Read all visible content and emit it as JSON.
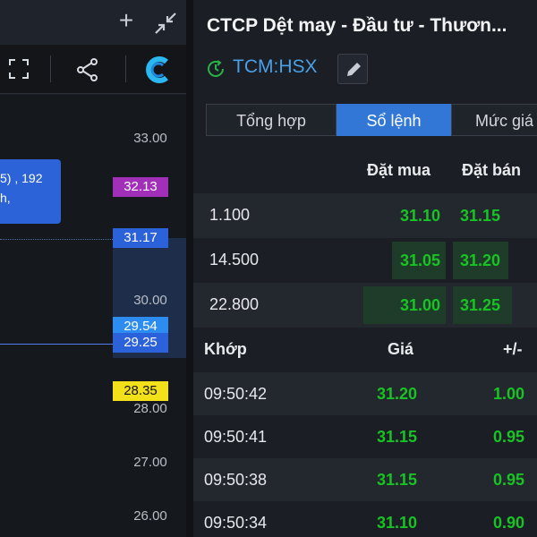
{
  "chart": {
    "price_ticks": [
      "33.00",
      "30.00",
      "28.00",
      "27.00",
      "26.00"
    ],
    "tooltip_line1": "5) , 192",
    "tooltip_line2": "h,",
    "labels": [
      {
        "text": "32.13",
        "bg": "#a22fb8",
        "color": "#ffffff"
      },
      {
        "text": "31.17",
        "bg": "#2c62d9",
        "color": "#ffffff"
      },
      {
        "text": "29.54",
        "bg": "#2d8cf0",
        "color": "#ffffff"
      },
      {
        "text": "29.25",
        "bg": "#2c62d9",
        "color": "#ffffff"
      },
      {
        "text": "28.35",
        "bg": "#f2e01b",
        "color": "#111111"
      }
    ],
    "icons": [
      "plus-icon",
      "shrink-icon",
      "fullscreen-icon",
      "share-icon",
      "logo-icon"
    ]
  },
  "stock": {
    "title": "CTCP Dệt may - Đầu tư - Thươn...",
    "ticker": "TCM:HSX",
    "tabs": [
      "Tổng hợp",
      "Sổ lệnh",
      "Mức giá"
    ],
    "active_tab": "Sổ lệnh",
    "orderbook": {
      "headers": {
        "bid": "Đặt mua",
        "ask": "Đặt bán"
      },
      "rows": [
        {
          "volume": "1.100",
          "bid": "31.10",
          "ask": "31.15"
        },
        {
          "volume": "14.500",
          "bid": "31.05",
          "ask": "31.20"
        },
        {
          "volume": "22.800",
          "bid": "31.00",
          "ask": "31.25"
        }
      ]
    },
    "trades": {
      "headers": {
        "time": "Khớp",
        "price": "Giá",
        "change": "+/-"
      },
      "rows": [
        {
          "time": "09:50:42",
          "price": "31.20",
          "change": "1.00"
        },
        {
          "time": "09:50:41",
          "price": "31.15",
          "change": "0.95"
        },
        {
          "time": "09:50:38",
          "price": "31.15",
          "change": "0.95"
        },
        {
          "time": "09:50:34",
          "price": "31.10",
          "change": "0.90"
        }
      ]
    },
    "colors": {
      "up": "#18c324",
      "accent": "#3377d6",
      "ticker": "#4aa0e6"
    }
  }
}
